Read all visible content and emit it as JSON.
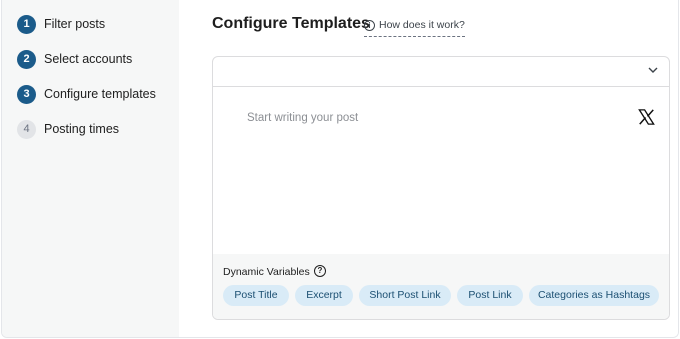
{
  "steps": [
    {
      "number": "1",
      "label": "Filter posts"
    },
    {
      "number": "2",
      "label": "Select accounts"
    },
    {
      "number": "3",
      "label": "Configure templates"
    },
    {
      "number": "4",
      "label": "Posting times"
    }
  ],
  "main": {
    "title": "Configure Templates",
    "how_link": "How does it work?",
    "how_icon": "info-icon"
  },
  "editor": {
    "placeholder": "Start writing your post",
    "network_icon": "x-logo-icon",
    "collapse_icon": "chevron-down-icon"
  },
  "dynamic_variables": {
    "label": "Dynamic Variables",
    "help_icon": "question-icon",
    "chips": [
      "Post Title",
      "Excerpt",
      "Short Post Link",
      "Post Link",
      "Categories as Hashtags"
    ]
  },
  "colors": {
    "step_active": "#1b5b8a",
    "chip_bg": "#d9ebf7",
    "sidebar_bg": "#f6f7f7"
  }
}
